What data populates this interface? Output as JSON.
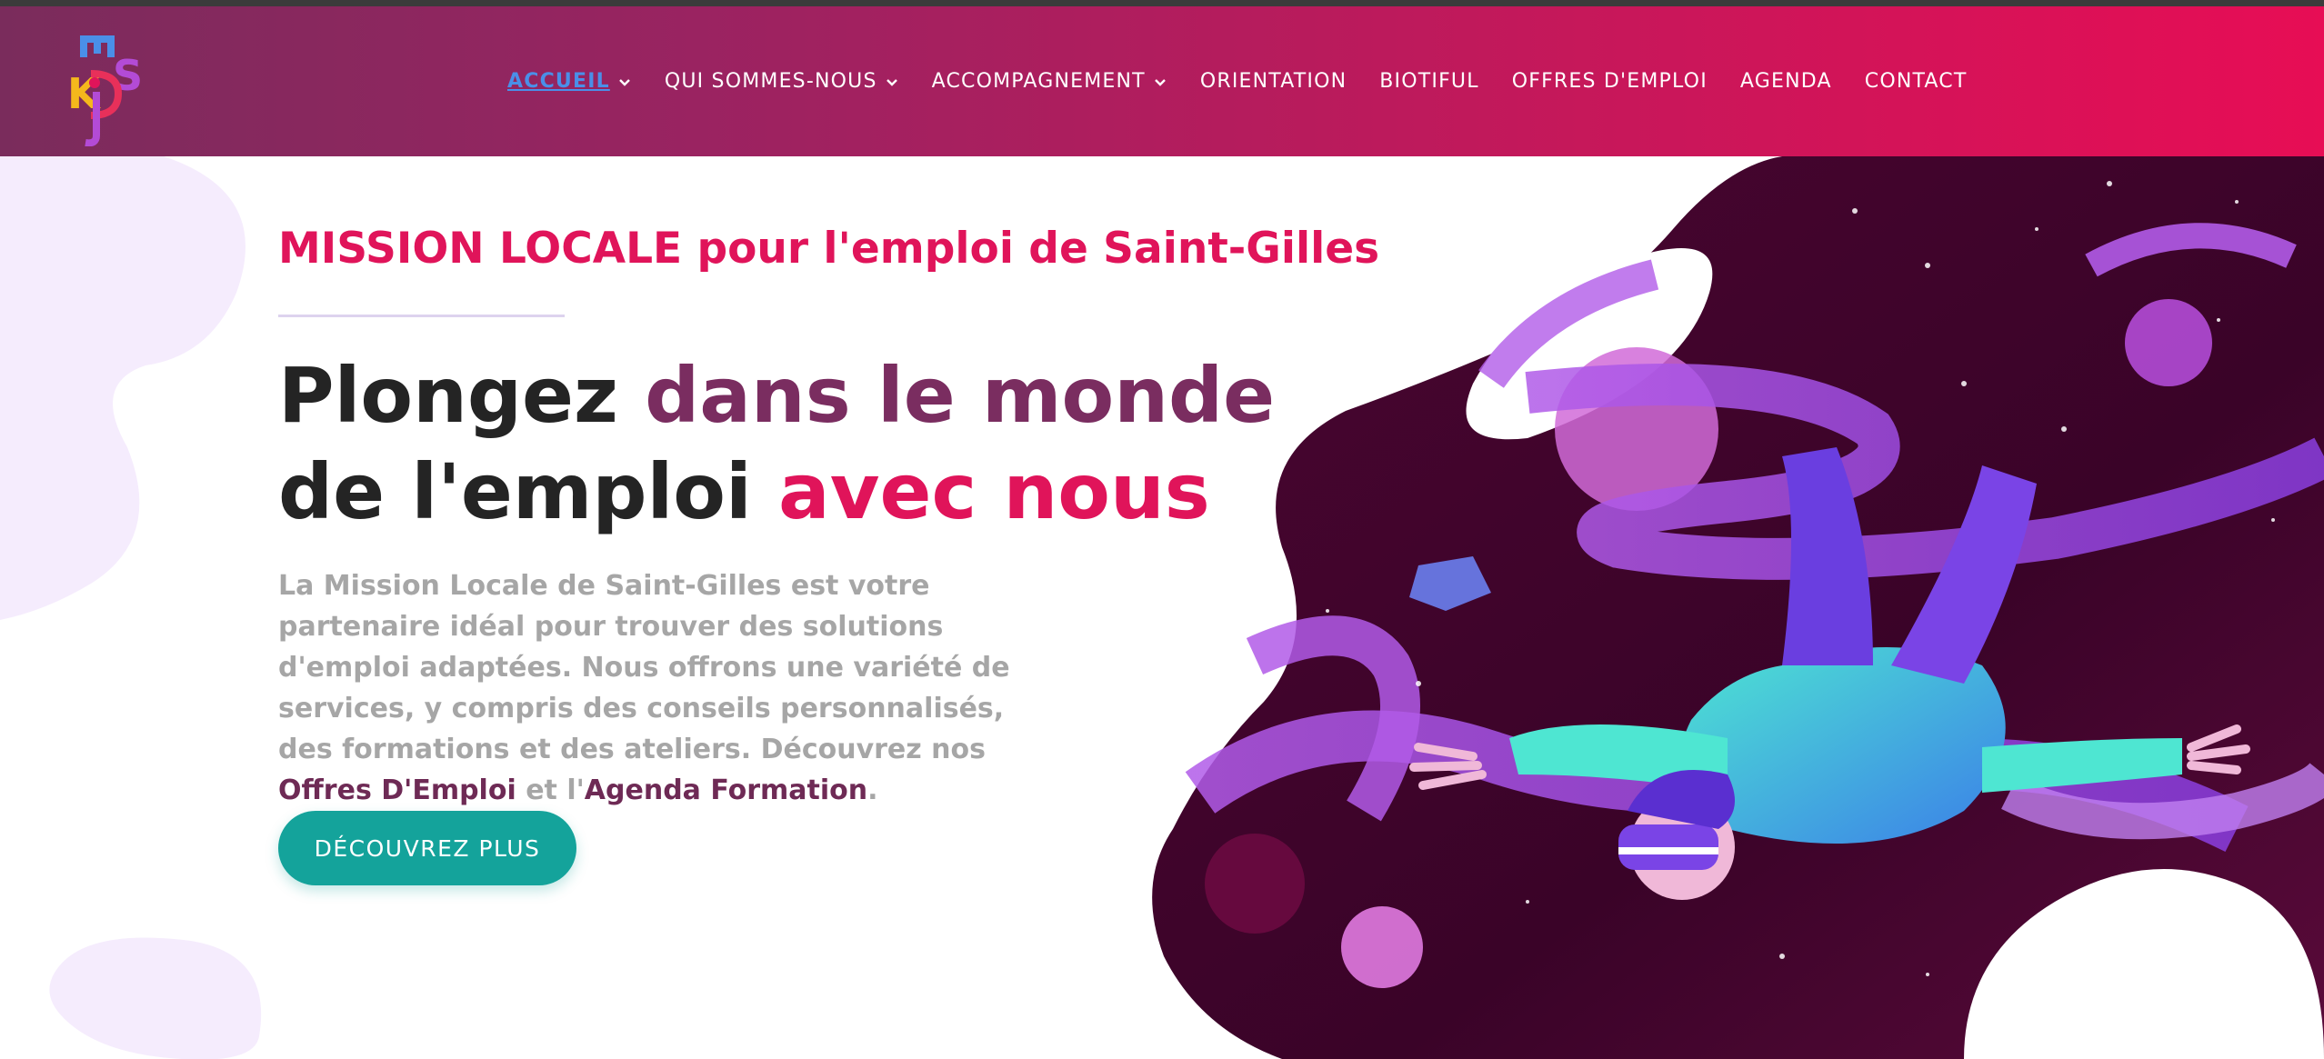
{
  "brand": {
    "logo_letters": "MJKDS",
    "logo_icon": "mjkds-logo"
  },
  "colors": {
    "accent_pink": "#e0145a",
    "accent_purple": "#7a2d60",
    "cta_teal": "#14a39b",
    "nav_active": "#4a8fe8"
  },
  "nav": {
    "items": [
      {
        "label": "ACCUEIL",
        "dropdown": true,
        "active": true
      },
      {
        "label": "QUI SOMMES-NOUS",
        "dropdown": true
      },
      {
        "label": "ACCOMPAGNEMENT",
        "dropdown": true
      },
      {
        "label": "ORIENTATION",
        "dropdown": false
      },
      {
        "label": "BIOTIFUL",
        "dropdown": false
      },
      {
        "label": "OFFRES D'EMPLOI",
        "dropdown": false
      },
      {
        "label": "AGENDA",
        "dropdown": false
      },
      {
        "label": "CONTACT",
        "dropdown": false
      }
    ]
  },
  "hero": {
    "subtitle": "MISSION LOCALE pour l'emploi de Saint-Gilles",
    "headline": {
      "part1": "Plongez ",
      "part2": "dans le monde",
      "part3": " de l'emploi ",
      "part4": "avec nous"
    },
    "description": {
      "text": "La Mission Locale de Saint-Gilles est votre partenaire idéal pour trouver des solutions d'emploi adaptées. Nous offrons une variété de services, y compris des conseils personnalisés, des formations et des ateliers. Découvrez nos ",
      "link1": "Offres D'Emploi",
      "middle": " et l'",
      "link2": "Agenda Formation",
      "end": "."
    },
    "cta_label": "DÉCOUVREZ PLUS",
    "illustration": "vr-diver-space-illustration"
  }
}
